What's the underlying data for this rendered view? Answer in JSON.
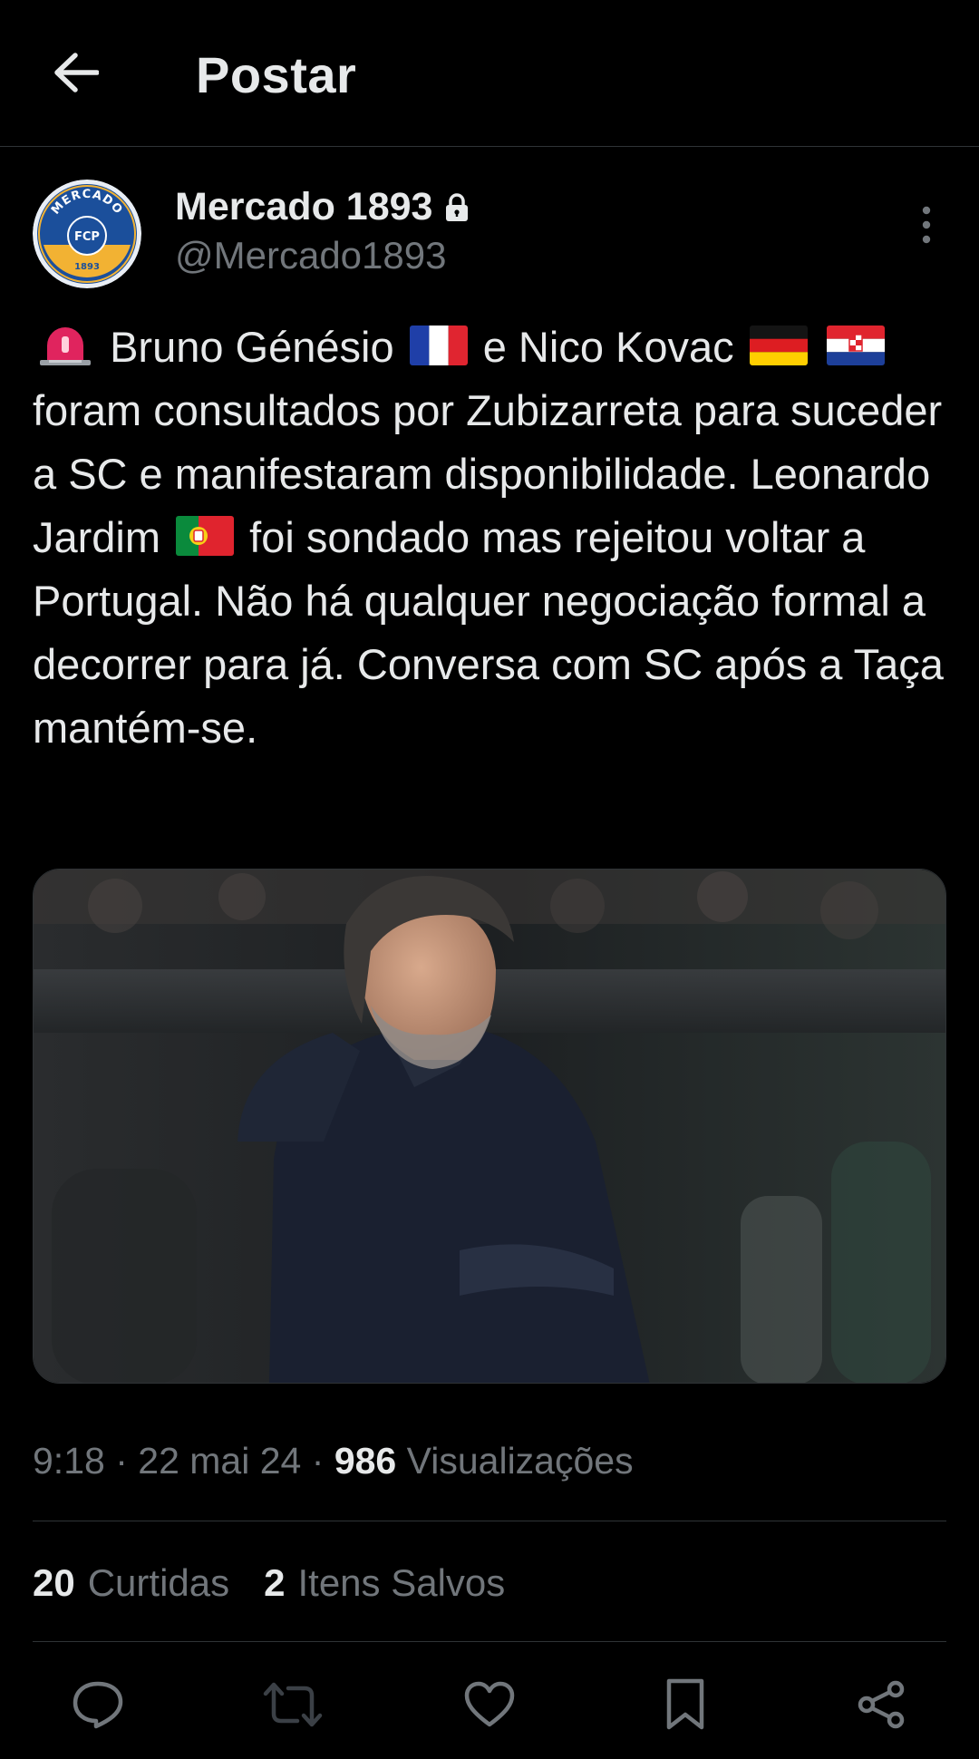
{
  "header": {
    "title": "Postar",
    "back_icon": "arrow-left-icon"
  },
  "author": {
    "display_name": "Mercado 1893",
    "handle": "@Mercado1893",
    "protected_icon": "lock-icon",
    "avatar_logo_text": [
      "MERCADO",
      "FCP",
      "1893"
    ]
  },
  "tweet": {
    "segments": {
      "s1": "Bruno Génésio",
      "s2": "e Nico Kovac",
      "s3": "foram consultados por Zubizarreta para suceder a SC e manifestaram disponibilidade. Leonardo Jardim",
      "s4": "foi sondado mas rejeitou voltar a Portugal. Não há qualquer negociação formal a decorrer para já. Conversa com SC após a Taça mantém-se."
    },
    "emojis": [
      "siren",
      "flag-france",
      "flag-germany",
      "flag-croatia",
      "flag-portugal"
    ]
  },
  "meta": {
    "time": "9:18",
    "date": "22 mai 24",
    "separator": "·",
    "views_count": "986",
    "views_label": "Visualizações"
  },
  "stats": {
    "likes_count": "20",
    "likes_label": "Curtidas",
    "bookmarks_count": "2",
    "bookmarks_label": "Itens Salvos"
  },
  "actions": [
    "reply-icon",
    "retweet-icon",
    "like-icon",
    "bookmark-icon",
    "share-icon"
  ],
  "colors": {
    "background": "#000000",
    "text": "#e7e9ea",
    "secondary": "#71767b",
    "divider": "#2f3336",
    "avatar_blue": "#1b4f9b",
    "avatar_gold": "#f2b233"
  }
}
